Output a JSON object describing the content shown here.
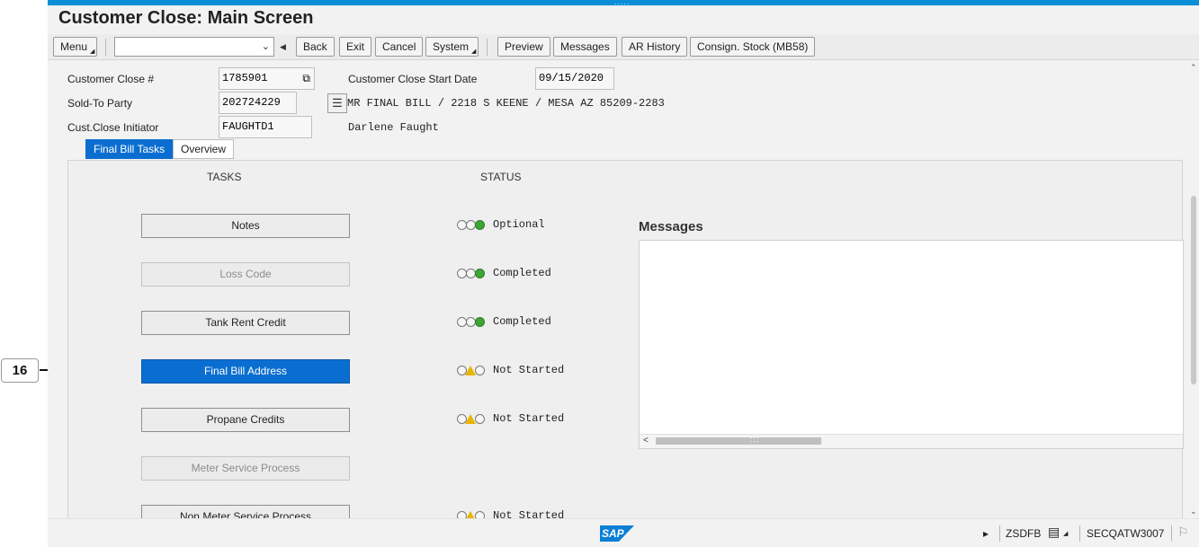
{
  "window": {
    "title": "Customer Close: Main Screen"
  },
  "toolbar": {
    "menu_label": "Menu",
    "command_field_value": "",
    "back_label": "Back",
    "exit_label": "Exit",
    "cancel_label": "Cancel",
    "system_label": "System",
    "preview_label": "Preview",
    "messages_label": "Messages",
    "ar_history_label": "AR History",
    "consign_stock_label": "Consign. Stock (MB58)"
  },
  "header": {
    "close_no_label": "Customer Close #",
    "close_no_value": "1785901",
    "start_date_label": "Customer Close Start Date",
    "start_date_value": "09/15/2020",
    "sold_to_label": "Sold-To Party",
    "sold_to_value": "202724229",
    "sold_to_description": "MR FINAL BILL / 2218 S KEENE / MESA AZ 85209-2283",
    "initiator_label": "Cust.Close Initiator",
    "initiator_value": "FAUGHTD1",
    "initiator_name": "Darlene Faught"
  },
  "tabs": [
    {
      "label": "Final Bill Tasks",
      "active": true
    },
    {
      "label": "Overview",
      "active": false
    }
  ],
  "tasks_panel": {
    "tasks_header": "TASKS",
    "status_header": "STATUS",
    "rows": [
      {
        "label": "Notes",
        "state": "enabled",
        "status": "Optional",
        "light": "green"
      },
      {
        "label": "Loss Code",
        "state": "disabled",
        "status": "Completed",
        "light": "green"
      },
      {
        "label": "Tank Rent Credit",
        "state": "enabled",
        "status": "Completed",
        "light": "green"
      },
      {
        "label": "Final Bill Address",
        "state": "selected",
        "status": "Not Started",
        "light": "yellow"
      },
      {
        "label": "Propane Credits",
        "state": "enabled",
        "status": "Not Started",
        "light": "yellow"
      },
      {
        "label": "Meter Service Process",
        "state": "disabled",
        "status": "",
        "light": ""
      },
      {
        "label": "Non Meter Service Process",
        "state": "enabled",
        "status": "Not Started",
        "light": "yellow"
      }
    ]
  },
  "messages": {
    "title": "Messages"
  },
  "statusbar": {
    "transaction": "ZSDFB",
    "server": "SECQATW3007",
    "logo_text": "SAP"
  },
  "annotation": {
    "callout_number": "16"
  },
  "colors": {
    "accent": "#0a6ed1",
    "topbar": "#0a8ed6",
    "light_green": "#3fa535",
    "light_yellow": "#e9b400"
  }
}
